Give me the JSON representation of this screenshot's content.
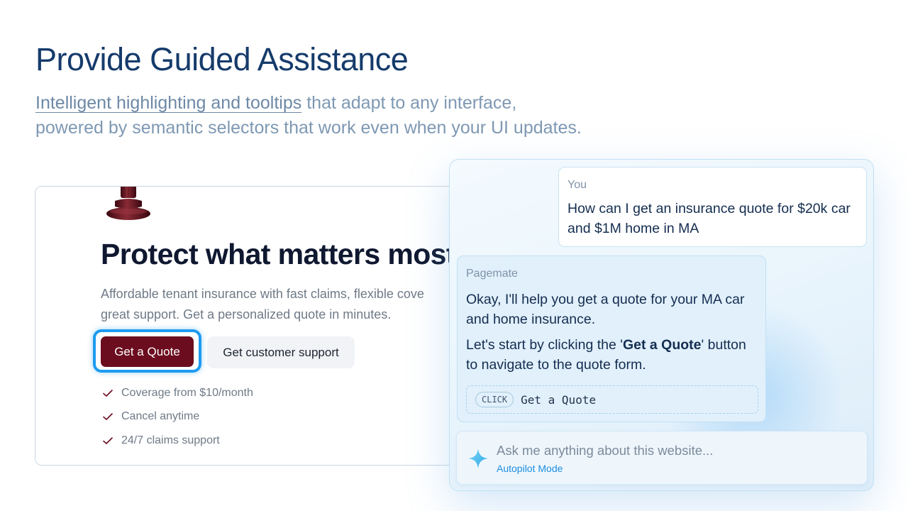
{
  "header": {
    "title": "Provide Guided Assistance",
    "subtitle_highlight": "Intelligent highlighting and tooltips",
    "subtitle_rest_line1": " that adapt to any interface,",
    "subtitle_line2": "powered by semantic selectors that work even when your UI updates."
  },
  "site_preview": {
    "title": "Protect what matters most.",
    "description_line1": "Affordable tenant insurance with fast claims, flexible cove",
    "description_line2": "great support. Get a personalized quote in minutes.",
    "primary_button": "Get a Quote",
    "secondary_button": "Get customer support",
    "features": [
      "Coverage from $10/month",
      "Cancel anytime",
      "24/7 claims support"
    ]
  },
  "assistant": {
    "user_message": {
      "sender": "You",
      "line1": "How can I get an insurance quote for $20k car",
      "line2": "and $1M home in MA"
    },
    "ai_message": {
      "sender": "Pagemate",
      "p1_line1": "Okay, I'll help you get a quote for your MA car",
      "p1_line2": "and home insurance.",
      "p2_line1_pre": "Let's start by clicking the '",
      "p2_line1_bold": "Get a Quote",
      "p2_line1_post": "' button",
      "p2_line2": "to navigate to the quote form.",
      "action_type": "CLICK",
      "action_target": "Get a Quote"
    },
    "input": {
      "placeholder": "Ask me anything about this website...",
      "mode": "Autopilot Mode"
    }
  },
  "colors": {
    "headline": "#153b6b",
    "primary_button": "#6b0d1f",
    "focus_ring": "#1e9bf0",
    "accent_link": "#1a8de0"
  },
  "icons": [
    "check-icon",
    "sparkle-icon",
    "product-image"
  ]
}
